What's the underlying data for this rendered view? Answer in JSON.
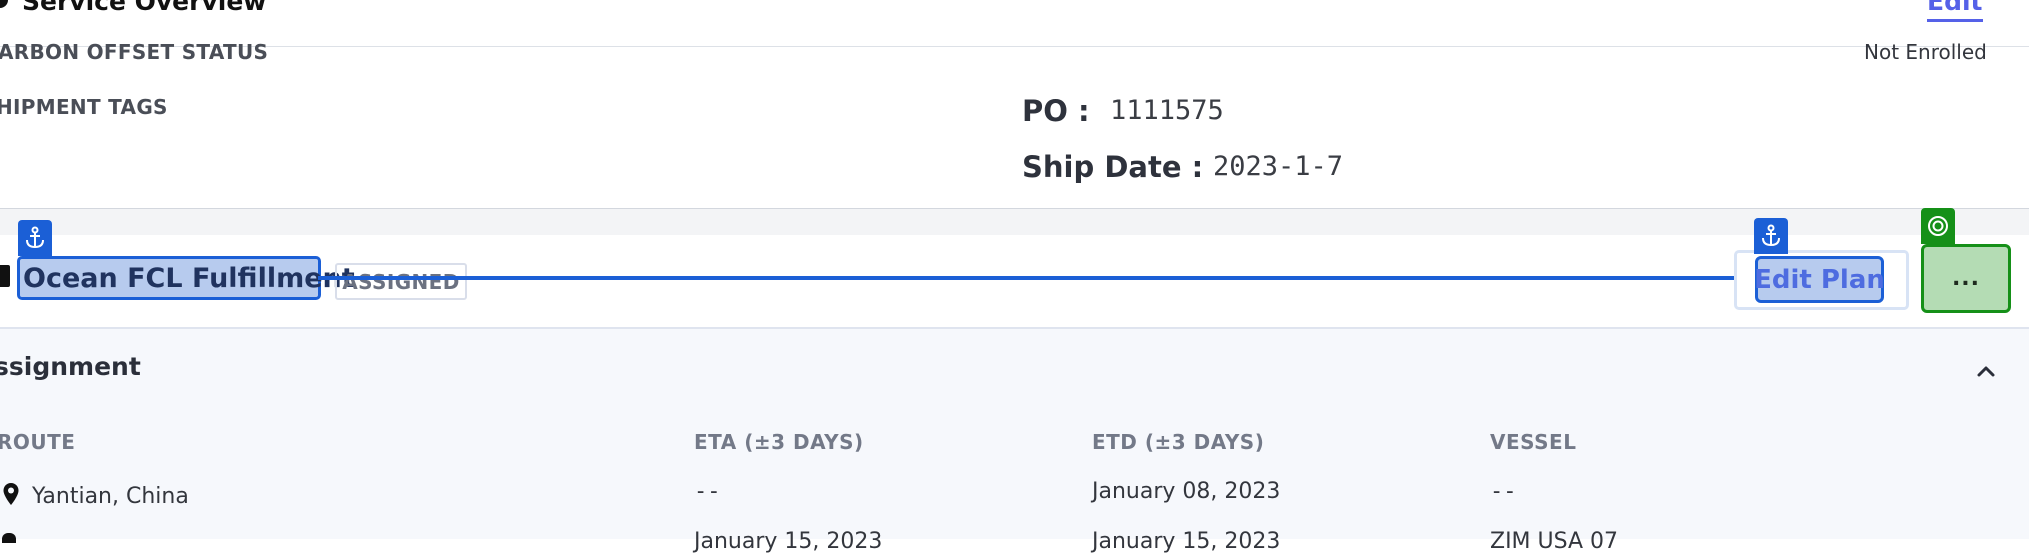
{
  "header": {
    "title": "Service Overview",
    "edit_label": "Edit"
  },
  "info": {
    "carbon_label": "ARBON OFFSET STATUS",
    "carbon_value": "Not Enrolled",
    "tags_label": "HIPMENT TAGS",
    "po_key": "PO :",
    "po_value": "1111575",
    "ship_date_key": "Ship Date :",
    "ship_date_value": "2023-1-7"
  },
  "plan": {
    "name": "Ocean FCL Fulfillment",
    "status": "ASSIGNED",
    "edit_plan_label": "Edit Plan",
    "more_label": "..."
  },
  "assignment": {
    "title": "ssignment",
    "columns": [
      "ROUTE",
      "ETA (±3 DAYS)",
      "ETD (±3 DAYS)",
      "VESSEL"
    ],
    "rows": [
      {
        "route": "Yantian, China",
        "eta": "--",
        "etd": "January 08, 2023",
        "vessel": "--"
      },
      {
        "route": "",
        "eta": "January 15, 2023",
        "etd": "January 15, 2023",
        "vessel": "ZIM USA 07"
      }
    ]
  },
  "icons": {
    "anchor": "anchor-icon",
    "target": "target-icon",
    "pin": "map-pin-icon",
    "collapse": "chevron-up-icon"
  },
  "colors": {
    "accent_blue": "#1b5fd6",
    "highlight_blue": "#b7cbee",
    "accent_green": "#159018",
    "highlight_green": "#b4dcb4",
    "link": "#5561e8"
  }
}
